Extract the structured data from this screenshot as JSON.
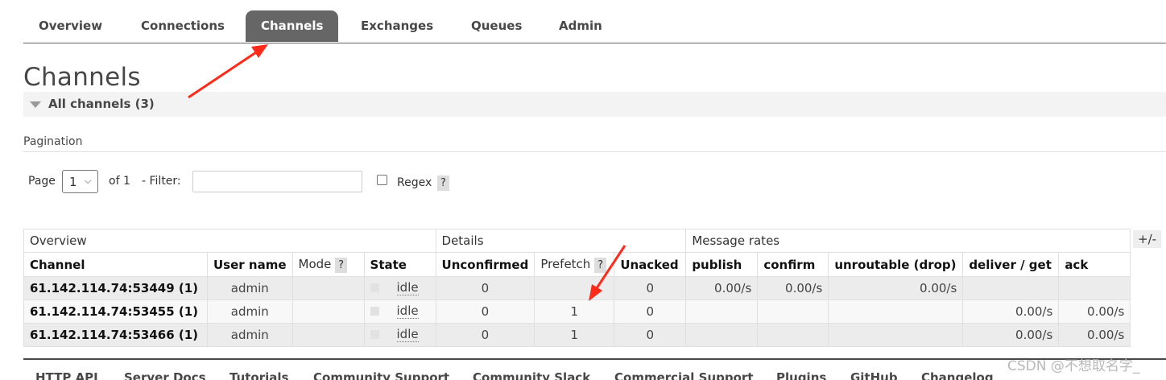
{
  "nav": {
    "tabs": [
      {
        "label": "Overview"
      },
      {
        "label": "Connections"
      },
      {
        "label": "Channels"
      },
      {
        "label": "Exchanges"
      },
      {
        "label": "Queues"
      },
      {
        "label": "Admin"
      }
    ],
    "active_tab": "Channels"
  },
  "page": {
    "title": "Channels",
    "section_label": "All channels (3)"
  },
  "pagination": {
    "title": "Pagination",
    "page_label": "Page",
    "page_value": "1",
    "of_label": "of 1",
    "filter_label": "- Filter:",
    "filter_value": "",
    "regex_label": "Regex",
    "regex_checked": false,
    "help_label": "?"
  },
  "table": {
    "groups": [
      "Overview",
      "Details",
      "Message rates"
    ],
    "columns": {
      "channel": "Channel",
      "user_name": "User name",
      "mode": "Mode",
      "mode_help": "?",
      "state": "State",
      "unconfirmed": "Unconfirmed",
      "prefetch": "Prefetch",
      "prefetch_help": "?",
      "unacked": "Unacked",
      "publish": "publish",
      "confirm": "confirm",
      "unroutable": "unroutable (drop)",
      "deliver_get": "deliver / get",
      "ack": "ack"
    },
    "toggle_columns_label": "+/-",
    "rows": [
      {
        "channel": "61.142.114.74:53449 (1)",
        "user_name": "admin",
        "mode": "",
        "state": "idle",
        "unconfirmed": "0",
        "prefetch": "",
        "unacked": "0",
        "publish": "0.00/s",
        "confirm": "0.00/s",
        "unroutable": "0.00/s",
        "deliver_get": "",
        "ack": ""
      },
      {
        "channel": "61.142.114.74:53455 (1)",
        "user_name": "admin",
        "mode": "",
        "state": "idle",
        "unconfirmed": "0",
        "prefetch": "1",
        "unacked": "0",
        "publish": "",
        "confirm": "",
        "unroutable": "",
        "deliver_get": "0.00/s",
        "ack": "0.00/s"
      },
      {
        "channel": "61.142.114.74:53466 (1)",
        "user_name": "admin",
        "mode": "",
        "state": "idle",
        "unconfirmed": "0",
        "prefetch": "1",
        "unacked": "0",
        "publish": "",
        "confirm": "",
        "unroutable": "",
        "deliver_get": "0.00/s",
        "ack": "0.00/s"
      }
    ]
  },
  "footer": {
    "links": [
      "HTTP API",
      "Server Docs",
      "Tutorials",
      "Community Support",
      "Community Slack",
      "Commercial Support",
      "Plugins",
      "GitHub",
      "Changelog"
    ]
  },
  "watermark": "CSDN @不想取名字_",
  "colors": {
    "active_tab_bg": "#666666",
    "annotation_arrow": "#ff2a1a"
  }
}
